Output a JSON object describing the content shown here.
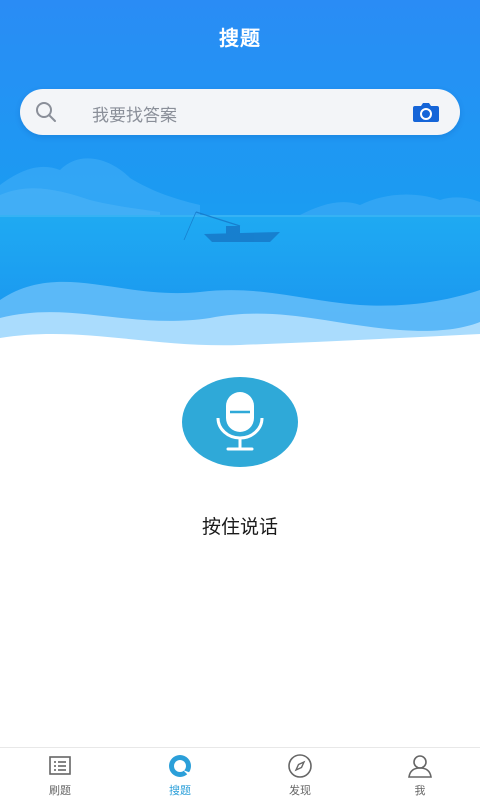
{
  "header": {
    "title": "搜题"
  },
  "search": {
    "placeholder": "我要找答案"
  },
  "voice": {
    "hint": "按住说话"
  },
  "tabs": [
    {
      "label": "刷题",
      "icon": "list-icon",
      "active": false
    },
    {
      "label": "搜题",
      "icon": "search-tab-icon",
      "active": true
    },
    {
      "label": "发现",
      "icon": "compass-icon",
      "active": false
    },
    {
      "label": "我",
      "icon": "user-icon",
      "active": false
    }
  ],
  "colors": {
    "sky_top": "#2a8cf5",
    "sky_bottom": "#1da1f2",
    "accent": "#2b9fd9",
    "mic_bg": "#2fa9d8",
    "camera": "#1565d8"
  }
}
